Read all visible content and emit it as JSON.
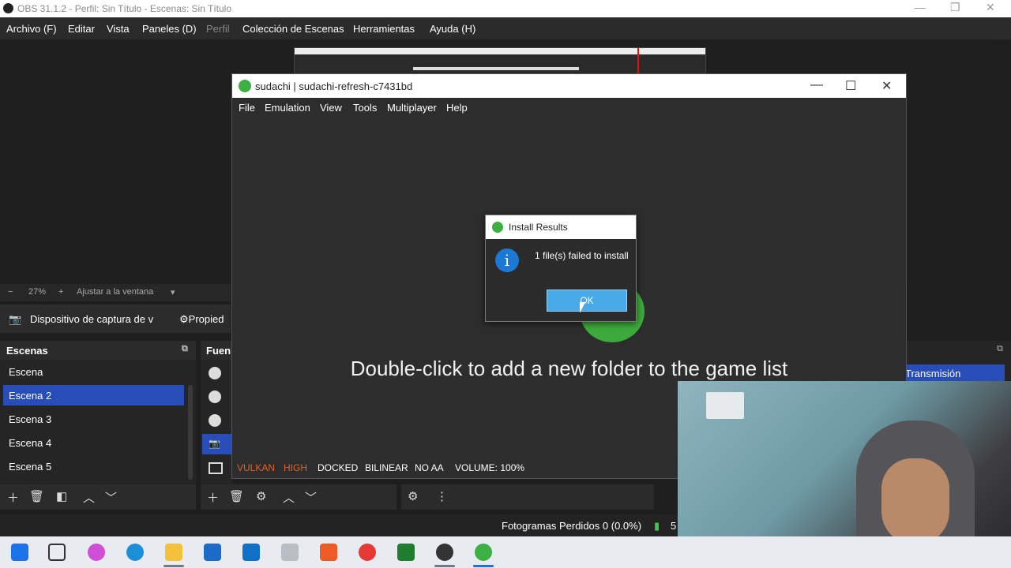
{
  "obs": {
    "title": "OBS 31.1.2 - Perfil: Sin Título - Escenas: Sin Título",
    "menu": [
      "Archivo (F)",
      "Editar",
      "Vista",
      "Paneles (D)",
      "Perfil",
      "Colección de Escenas",
      "Herramientas",
      "Ayuda (H)"
    ],
    "zoom": {
      "minus": "−",
      "percent": "27%",
      "plus": "+",
      "fit": "Ajustar a la ventana",
      "caret": "▾"
    },
    "source_bar": {
      "source": "Dispositivo de captura de v",
      "properties": "Propied"
    },
    "scenes": {
      "title": "Escenas",
      "items": [
        "Escena",
        "Escena 2",
        "Escena 3",
        "Escena 4",
        "Escena 5"
      ],
      "selected_index": 1
    },
    "sources": {
      "title": "Fuen"
    },
    "right_dock": {
      "transmit": "Transmisión"
    },
    "status": {
      "dropped": "Fotogramas Perdidos 0 (0.0%)",
      "extra": "5"
    }
  },
  "sudachi": {
    "title": "sudachi | sudachi-refresh-c7431bd",
    "menu": [
      "File",
      "Emulation",
      "View",
      "Tools",
      "Multiplayer",
      "Help"
    ],
    "hint": "Double-click to add a new folder to the game list",
    "status": [
      {
        "text": "VULKAN",
        "color": "#e0632a"
      },
      {
        "text": "HIGH",
        "color": "#e0632a"
      },
      {
        "text": "DOCKED",
        "color": "#ffffff"
      },
      {
        "text": "BILINEAR",
        "color": "#ffffff"
      },
      {
        "text": "NO AA",
        "color": "#ffffff"
      },
      {
        "text": "VOLUME: 100%",
        "color": "#ffffff"
      }
    ]
  },
  "dialog": {
    "title": "Install Results",
    "message": "1 file(s) failed to install",
    "info_glyph": "i",
    "ok": "OK"
  },
  "colors": {
    "accent": "#284cb8",
    "ok_button": "#47a9e6",
    "sudachi_green": "#3cb043"
  }
}
